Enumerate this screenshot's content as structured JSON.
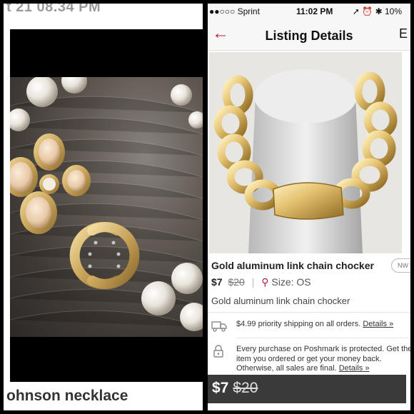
{
  "left_panel": {
    "timestamp_fragment": "t 21 08.34 PM",
    "caption_fragment": "ohnson necklace"
  },
  "status_bar": {
    "carrier": "●●○○○ Sprint",
    "time": "11:02 PM",
    "battery": "10%"
  },
  "nav": {
    "title": "Listing Details",
    "back_icon": "arrow-left-icon",
    "more_label": "E"
  },
  "listing": {
    "title": "Gold aluminum link chain chocker",
    "condition_badge": "NW",
    "price": "$7",
    "original_price": "$20",
    "size_label": "Size: OS",
    "description": "Gold aluminum link chain chocker"
  },
  "shipping": {
    "text": "$4.99 priority shipping on all orders.",
    "link": "Details »"
  },
  "protection": {
    "text": "Every purchase on Poshmark is protected. Get the item you ordered or get your money back. Otherwise, all sales are final.",
    "link": "Details »"
  },
  "bottom_bar": {
    "price": "$7",
    "original_price": "$20"
  },
  "colors": {
    "accent": "#b0203a",
    "bottom_bar": "#3a3a3a"
  }
}
